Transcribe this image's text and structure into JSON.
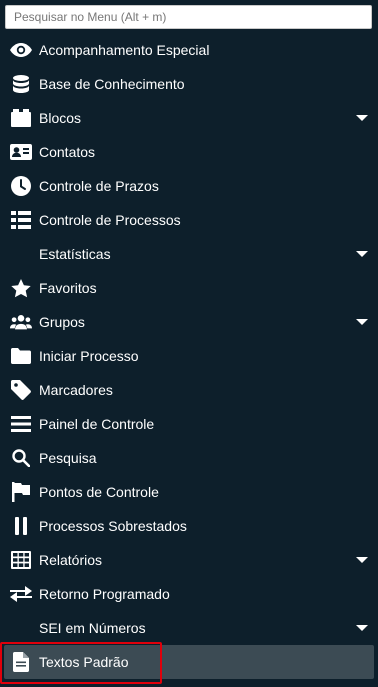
{
  "search": {
    "placeholder": "Pesquisar no Menu (Alt + m)",
    "value": ""
  },
  "menu": {
    "items": [
      {
        "label": "Acompanhamento Especial",
        "icon": "eye-icon",
        "has_submenu": false
      },
      {
        "label": "Base de Conhecimento",
        "icon": "database-icon",
        "has_submenu": false
      },
      {
        "label": "Blocos",
        "icon": "blocks-icon",
        "has_submenu": true
      },
      {
        "label": "Contatos",
        "icon": "contact-card-icon",
        "has_submenu": false
      },
      {
        "label": "Controle de Prazos",
        "icon": "clock-icon",
        "has_submenu": false
      },
      {
        "label": "Controle de Processos",
        "icon": "list-icon",
        "has_submenu": false
      },
      {
        "label": "Estatísticas",
        "icon": "",
        "has_submenu": true
      },
      {
        "label": "Favoritos",
        "icon": "star-icon",
        "has_submenu": false
      },
      {
        "label": "Grupos",
        "icon": "users-icon",
        "has_submenu": true
      },
      {
        "label": "Iniciar Processo",
        "icon": "folder-icon",
        "has_submenu": false
      },
      {
        "label": "Marcadores",
        "icon": "tag-icon",
        "has_submenu": false
      },
      {
        "label": "Painel de Controle",
        "icon": "panel-icon",
        "has_submenu": false
      },
      {
        "label": "Pesquisa",
        "icon": "search-icon",
        "has_submenu": false
      },
      {
        "label": "Pontos de Controle",
        "icon": "flag-icon",
        "has_submenu": false
      },
      {
        "label": "Processos Sobrestados",
        "icon": "pause-icon",
        "has_submenu": false
      },
      {
        "label": "Relatórios",
        "icon": "table-icon",
        "has_submenu": true
      },
      {
        "label": "Retorno Programado",
        "icon": "exchange-icon",
        "has_submenu": false
      },
      {
        "label": "SEI em Números",
        "icon": "",
        "has_submenu": true
      },
      {
        "label": "Textos Padrão",
        "icon": "document-icon",
        "has_submenu": false,
        "selected": true
      }
    ]
  },
  "colors": {
    "background": "#0d1f2b",
    "selected_background": "#3c4b54",
    "highlight_border": "#e0000b",
    "text": "#ffffff"
  }
}
